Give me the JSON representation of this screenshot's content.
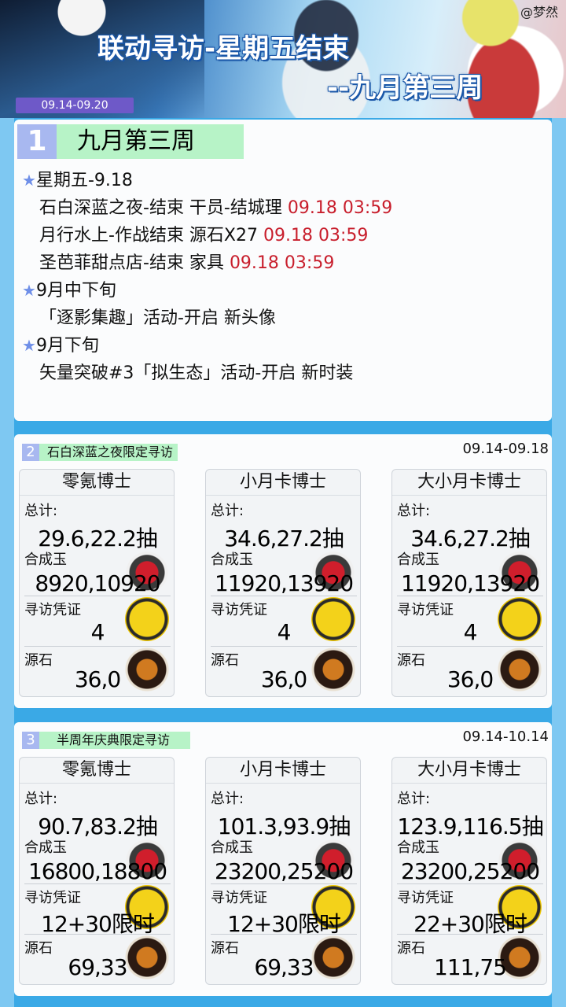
{
  "header": {
    "handle": "@梦然",
    "title_line1": "联动寻访-星期五结束",
    "title_line2": "--九月第三周",
    "date_range": "09.14-09.20"
  },
  "section1": {
    "number": "1",
    "heading": "九月第三周",
    "rows": [
      {
        "type": "group",
        "text": "星期五-9.18"
      },
      {
        "type": "item",
        "text": "石白深蓝之夜-结束 干员-结城理 ",
        "time": "09.18 03:59"
      },
      {
        "type": "item",
        "text": "月行水上-作战结束 源石X27 ",
        "time": "09.18 03:59"
      },
      {
        "type": "item",
        "text": "圣芭菲甜点店-结束 家具 ",
        "time": "09.18 03:59"
      },
      {
        "type": "group",
        "text": "9月中下旬"
      },
      {
        "type": "item",
        "text": "「逐影集趣」活动-开启 新头像",
        "time": ""
      },
      {
        "type": "group",
        "text": "9月下旬"
      },
      {
        "type": "item",
        "text": "矢量突破#3「拟生态」活动-开启 新时装",
        "time": ""
      }
    ]
  },
  "labels": {
    "total": "总计:",
    "orundum": "合成玉",
    "permit": "寻访凭证",
    "prime": "源石"
  },
  "section2": {
    "number": "2",
    "title": "石白深蓝之夜限定寻访",
    "date": "09.14-09.18",
    "cards": [
      {
        "title": "零氪博士",
        "total": "29.6,22.2抽",
        "orundum": "8920,10920",
        "permit": "4",
        "prime": "36,0"
      },
      {
        "title": "小月卡博士",
        "total": "34.6,27.2抽",
        "orundum": "11920,13920",
        "permit": "4",
        "prime": "36,0"
      },
      {
        "title": "大小月卡博士",
        "total": "34.6,27.2抽",
        "orundum": "11920,13920",
        "permit": "4",
        "prime": "36,0"
      }
    ]
  },
  "section3": {
    "number": "3",
    "title": "半周年庆典限定寻访",
    "date": "09.14-10.14",
    "cards": [
      {
        "title": "零氪博士",
        "total": "90.7,83.2抽",
        "orundum": "16800,18800",
        "permit": "12+30限时",
        "prime": "69,33"
      },
      {
        "title": "小月卡博士",
        "total": "101.3,93.9抽",
        "orundum": "23200,25200",
        "permit": "12+30限时",
        "prime": "69,33"
      },
      {
        "title": "大小月卡博士",
        "total": "123.9,116.5抽",
        "orundum": "23200,25200",
        "permit": "22+30限时",
        "prime": "111,75"
      }
    ]
  },
  "icons": {
    "star": "star-icon",
    "orundum": "orundum-icon",
    "permit": "headhunting-permit-icon",
    "prime": "originite-prime-icon"
  }
}
